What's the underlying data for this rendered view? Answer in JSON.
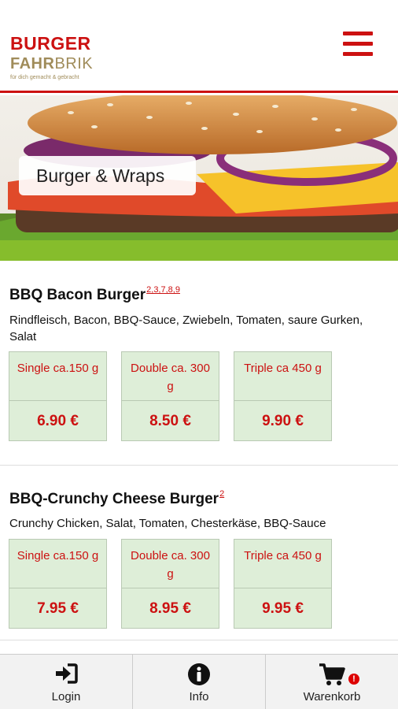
{
  "header": {
    "logo_line1": "BURGER",
    "logo_line2a": "FAHR",
    "logo_line2b": "BRIK",
    "logo_tagline": "für dich gemacht & gebracht",
    "menu_icon": "hamburger-menu-icon"
  },
  "hero": {
    "category": "Burger & Wraps",
    "accent": "#86bd2c"
  },
  "items": [
    {
      "name": "BBQ Bacon Burger",
      "footnotes": "2,3,7,8,9",
      "description": "Rindfleisch, Bacon, BBQ-Sauce, Zwiebeln, Tomaten, saure Gurken, Salat",
      "options": [
        {
          "size": "Single ca.150 g",
          "price": "6.90 €"
        },
        {
          "size": "Double ca. 300 g",
          "price": "8.50 €"
        },
        {
          "size": "Triple ca 450 g",
          "price": "9.90 €"
        }
      ]
    },
    {
      "name": "BBQ-Crunchy Cheese Burger",
      "footnotes": "2",
      "description": "Crunchy Chicken, Salat, Tomaten, Chesterkäse, BBQ-Sauce",
      "options": [
        {
          "size": "Single ca.150 g",
          "price": "7.95 €"
        },
        {
          "size": "Double ca. 300 g",
          "price": "8.95 €"
        },
        {
          "size": "Triple ca 450 g",
          "price": "9.95 €"
        }
      ]
    }
  ],
  "tabbar": {
    "login": "Login",
    "info": "Info",
    "cart": "Warenkorb",
    "cart_badge": "!"
  },
  "colors": {
    "brand_red": "#cc1111",
    "price_bg": "#deeed8",
    "green_bar": "#86bd2c"
  }
}
